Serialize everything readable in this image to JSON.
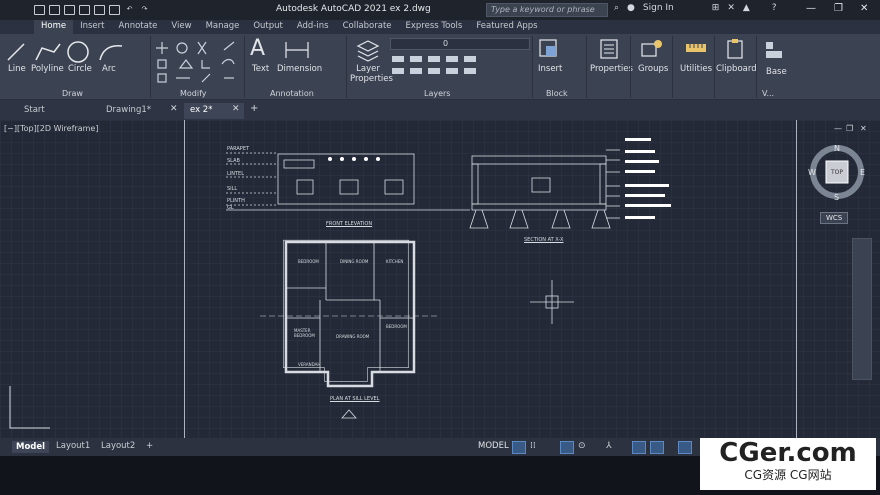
{
  "title": "Autodesk AutoCAD 2021   ex 2.dwg",
  "search_placeholder": "Type a keyword or phrase",
  "signin": "Sign In",
  "ribbon_tabs": [
    "Home",
    "Insert",
    "Annotate",
    "View",
    "Manage",
    "Output",
    "Add-ins",
    "Collaborate",
    "Express Tools",
    "Featured Apps"
  ],
  "draw_tools": [
    "Line",
    "Polyline",
    "Circle",
    "Arc"
  ],
  "panels": {
    "draw": "Draw",
    "modify": "Modify",
    "annotation": "Annotation",
    "layers": "Layers",
    "block": "Block",
    "view": "V..."
  },
  "annotation_tools": [
    "Text",
    "Dimension"
  ],
  "layer_tools": {
    "props": "Layer Properties",
    "current": "0"
  },
  "other_tools": [
    "Insert",
    "Properties",
    "Groups",
    "Utilities",
    "Clipboard",
    "Base"
  ],
  "file_tabs": [
    "Start",
    "Drawing1*",
    "ex 2*"
  ],
  "view_label": "[−][Top][2D Wireframe]",
  "layout_tabs": [
    "Model",
    "Layout1",
    "Layout2"
  ],
  "status_model": "MODEL",
  "viewcube": {
    "top": "TOP",
    "n": "N",
    "s": "S",
    "e": "E",
    "w": "W",
    "wcs": "WCS"
  },
  "drawing_labels": {
    "elev": "FRONT ELEVATION",
    "section": "SECTION AT X-X",
    "plan": "PLAN AT SILL LEVEL",
    "levels": [
      "PARAPET",
      "SLAB",
      "LINTEL",
      "SILL",
      "PLINTH",
      "GL"
    ],
    "rooms": [
      "BEDROOM",
      "DINING ROOM",
      "KITCHEN",
      "MASTER BEDROOM",
      "DRAWING ROOM",
      "BEDROOM",
      "VERANDAH"
    ]
  },
  "watermark": {
    "big": "CGer.com",
    "small": "CG资源  CG网站"
  }
}
